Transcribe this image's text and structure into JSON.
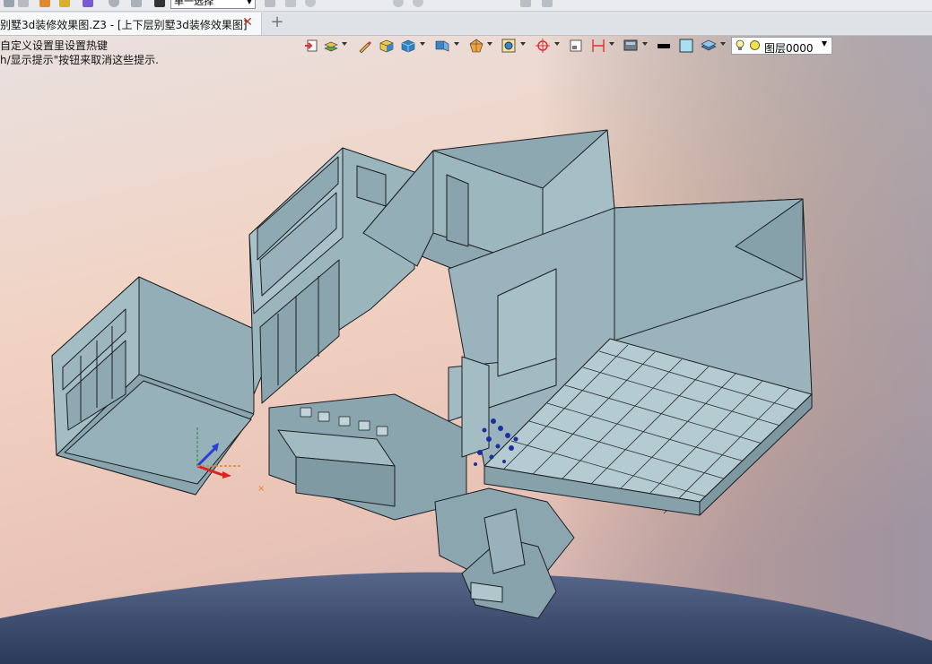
{
  "top_toolbar": {
    "selection_mode": "单一选择"
  },
  "tabs": [
    {
      "label": "别墅3d装修效果图.Z3 - [上下层别墅3d装修效果图]",
      "active": true
    }
  ],
  "tab_add_label": "+",
  "tab_close_label": "✕",
  "hints": {
    "line1": "自定义设置里设置热键",
    "line2": "h/显示提示\"按钮来取消这些提示."
  },
  "view_toolbar": {
    "icons": [
      "exit-sketch-icon",
      "layer-stack-icon",
      "pencil-icon",
      "box-shaded-icon",
      "cube-icon",
      "view-cube-icon",
      "render-style-icon",
      "zoom-fit-icon",
      "snap-target-icon",
      "section-view-icon",
      "dimension-icon",
      "display-mode-icon",
      "line-color-icon",
      "fill-color-icon",
      "layers-icon"
    ],
    "layer": {
      "name": "图层0000"
    }
  },
  "colors": {
    "model_fill": "#93aeb7",
    "model_dark": "#6f8a93",
    "model_light": "#a9c1c9",
    "edge": "#1a1f22",
    "sky_top": "#e7dcdc",
    "sky_warm": "#f0c8b5",
    "horizon_dark": "#3c4d6c"
  }
}
